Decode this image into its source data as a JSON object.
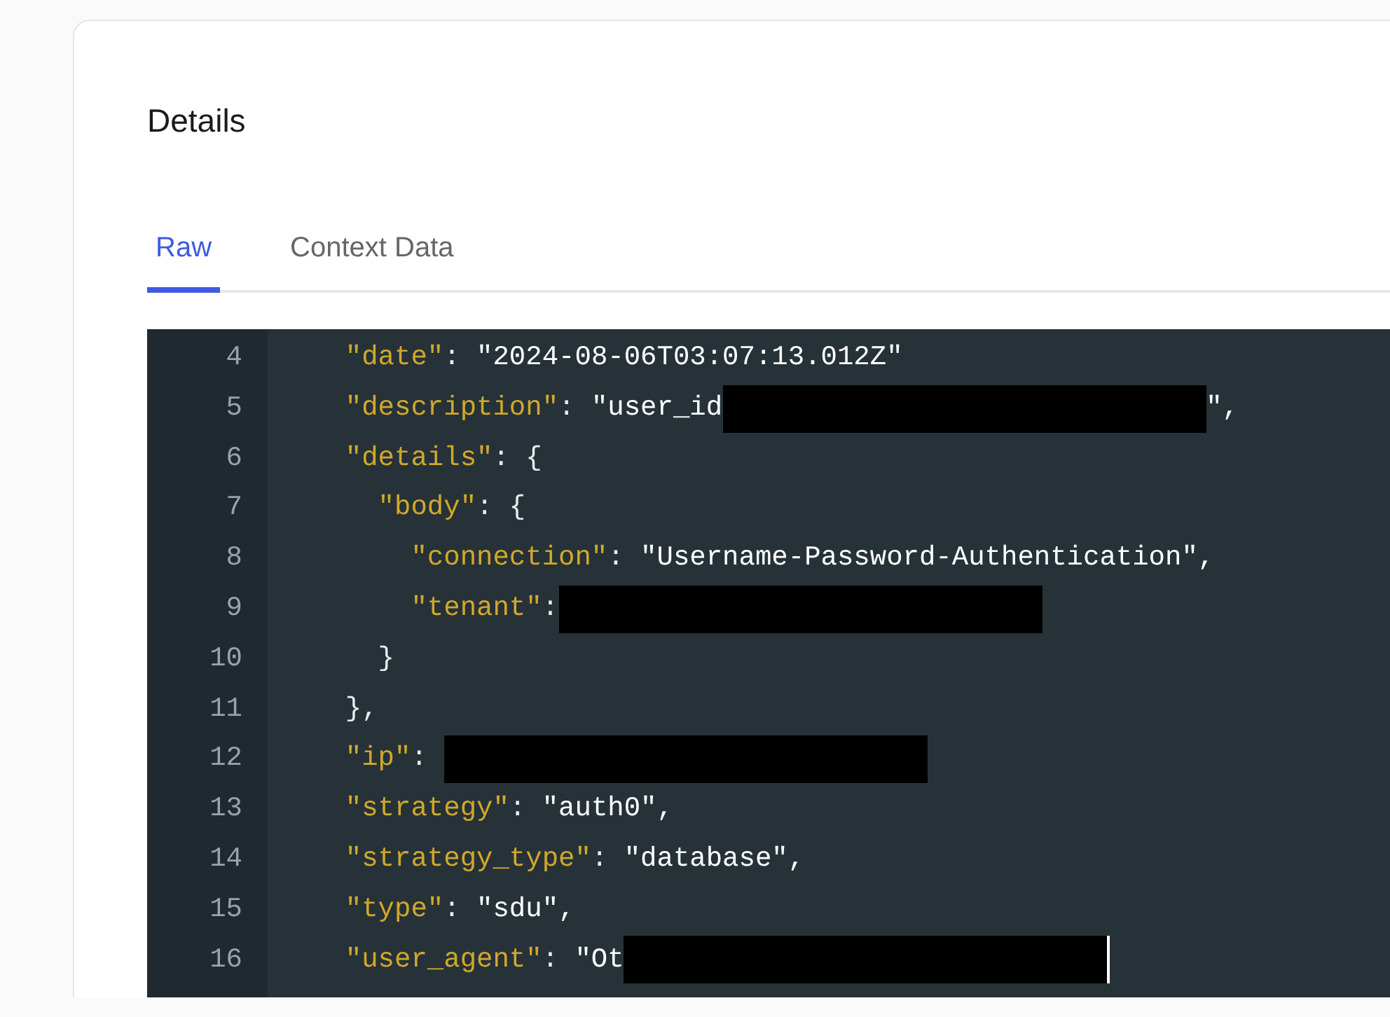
{
  "card": {
    "title": "Details"
  },
  "tabs": [
    {
      "label": "Raw",
      "selected": true
    },
    {
      "label": "Context Data",
      "selected": false
    }
  ],
  "code": {
    "lines": [
      {
        "number": "4",
        "tokens": [
          {
            "kind": "key",
            "text": "  \"date\""
          },
          {
            "kind": "punct",
            "text": ": "
          },
          {
            "kind": "string",
            "text": "\"2024-08-06T03:07:13.012Z\""
          }
        ]
      },
      {
        "number": "5",
        "tokens": [
          {
            "kind": "key",
            "text": "  \"description\""
          },
          {
            "kind": "punct",
            "text": ": "
          },
          {
            "kind": "string",
            "text": "\"user_id"
          },
          {
            "kind": "redaction"
          },
          {
            "kind": "string",
            "text": "\","
          }
        ]
      },
      {
        "number": "6",
        "tokens": [
          {
            "kind": "key",
            "text": "  \"details\""
          },
          {
            "kind": "punct",
            "text": ": {"
          }
        ]
      },
      {
        "number": "7",
        "tokens": [
          {
            "kind": "key",
            "text": "    \"body\""
          },
          {
            "kind": "punct",
            "text": ": {"
          }
        ]
      },
      {
        "number": "8",
        "tokens": [
          {
            "kind": "key",
            "text": "      \"connection\""
          },
          {
            "kind": "punct",
            "text": ": "
          },
          {
            "kind": "string",
            "text": "\"Username-Password-Authentication\","
          }
        ]
      },
      {
        "number": "9",
        "tokens": [
          {
            "kind": "key",
            "text": "      \"tenant\""
          },
          {
            "kind": "punct",
            "text": ":"
          },
          {
            "kind": "redaction"
          }
        ]
      },
      {
        "number": "10",
        "tokens": [
          {
            "kind": "punct",
            "text": "    }"
          }
        ]
      },
      {
        "number": "11",
        "tokens": [
          {
            "kind": "punct",
            "text": "  },"
          }
        ]
      },
      {
        "number": "12",
        "tokens": [
          {
            "kind": "key",
            "text": "  \"ip\""
          },
          {
            "kind": "punct",
            "text": ": "
          },
          {
            "kind": "redaction"
          }
        ]
      },
      {
        "number": "13",
        "tokens": [
          {
            "kind": "key",
            "text": "  \"strategy\""
          },
          {
            "kind": "punct",
            "text": ": "
          },
          {
            "kind": "string",
            "text": "\"auth0\","
          }
        ]
      },
      {
        "number": "14",
        "tokens": [
          {
            "kind": "key",
            "text": "  \"strategy_type\""
          },
          {
            "kind": "punct",
            "text": ": "
          },
          {
            "kind": "string",
            "text": "\"database\","
          }
        ]
      },
      {
        "number": "15",
        "tokens": [
          {
            "kind": "key",
            "text": "  \"type\""
          },
          {
            "kind": "punct",
            "text": ": "
          },
          {
            "kind": "string",
            "text": "\"sdu\","
          }
        ]
      },
      {
        "number": "16",
        "tokens": [
          {
            "kind": "key",
            "text": "  \"user_agent\""
          },
          {
            "kind": "punct",
            "text": ": "
          },
          {
            "kind": "string",
            "text": "\"Ot"
          },
          {
            "kind": "redaction"
          },
          {
            "kind": "cursor"
          }
        ]
      }
    ]
  }
}
